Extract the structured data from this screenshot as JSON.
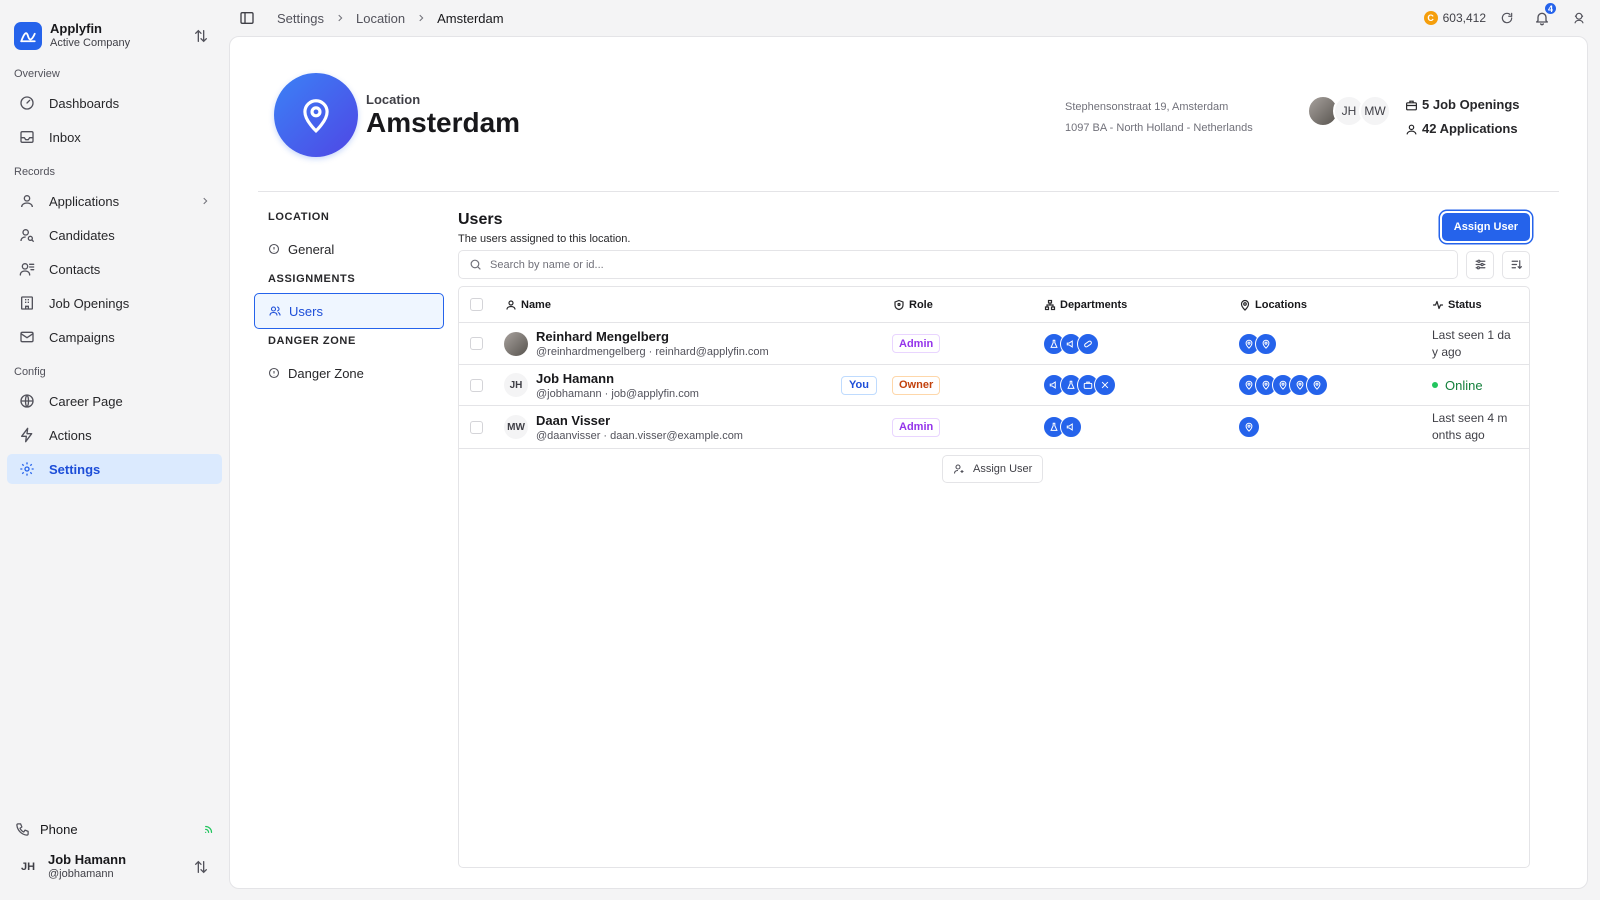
{
  "company": {
    "name": "Applyfin",
    "subtitle": "Active Company"
  },
  "sidebar": {
    "overview_label": "Overview",
    "records_label": "Records",
    "config_label": "Config",
    "items": {
      "dashboards": "Dashboards",
      "inbox": "Inbox",
      "applications": "Applications",
      "candidates": "Candidates",
      "contacts": "Contacts",
      "job_openings": "Job Openings",
      "campaigns": "Campaigns",
      "career_page": "Career Page",
      "actions": "Actions",
      "settings": "Settings"
    },
    "phone": "Phone",
    "user": {
      "initials": "JH",
      "name": "Job Hamann",
      "handle": "@jobhamann"
    }
  },
  "topbar": {
    "breadcrumbs": [
      "Settings",
      "Location",
      "Amsterdam"
    ],
    "coin_symbol": "C",
    "credits": "603,412",
    "notification_count": "4"
  },
  "location": {
    "label": "Location",
    "name": "Amsterdam",
    "address_line1": "Stephensonstraat 19, Amsterdam",
    "address_line2": "1097 BA - North Holland - Netherlands",
    "avatars": [
      "",
      "JH",
      "MW"
    ],
    "job_openings": "5 Job Openings",
    "applications": "42 Applications"
  },
  "subnav": {
    "location_head": "LOCATION",
    "general": "General",
    "assignments_head": "ASSIGNMENTS",
    "users": "Users",
    "danger_head": "DANGER ZONE",
    "danger": "Danger Zone"
  },
  "users_panel": {
    "title": "Users",
    "subtitle": "The users assigned to this location.",
    "assign_button": "Assign User",
    "search_placeholder": "Search by name or id...",
    "columns": {
      "name": "Name",
      "role": "Role",
      "departments": "Departments",
      "locations": "Locations",
      "status": "Status"
    },
    "rows": [
      {
        "initials": "",
        "name": "Reinhard Mengelberg",
        "handle": "@reinhardmengelberg · reinhard@applyfin.com",
        "you": "",
        "role": "Admin",
        "departments": [
          "flask-icon",
          "megaphone-icon",
          "pill-icon"
        ],
        "locations": 2,
        "status": "Last seen 1 da y ago"
      },
      {
        "initials": "JH",
        "name": "Job Hamann",
        "handle": "@jobhamann · job@applyfin.com",
        "you": "You",
        "role": "Owner",
        "departments": [
          "megaphone-icon",
          "flask-icon",
          "briefcase-icon",
          "tools-icon"
        ],
        "locations": 5,
        "status": "Online"
      },
      {
        "initials": "MW",
        "name": "Daan Visser",
        "handle": "@daanvisser · daan.visser@example.com",
        "you": "",
        "role": "Admin",
        "departments": [
          "flask-icon",
          "megaphone-icon"
        ],
        "locations": 1,
        "status": "Last seen 4 m onths ago"
      }
    ],
    "assign_bottom": "Assign User"
  }
}
